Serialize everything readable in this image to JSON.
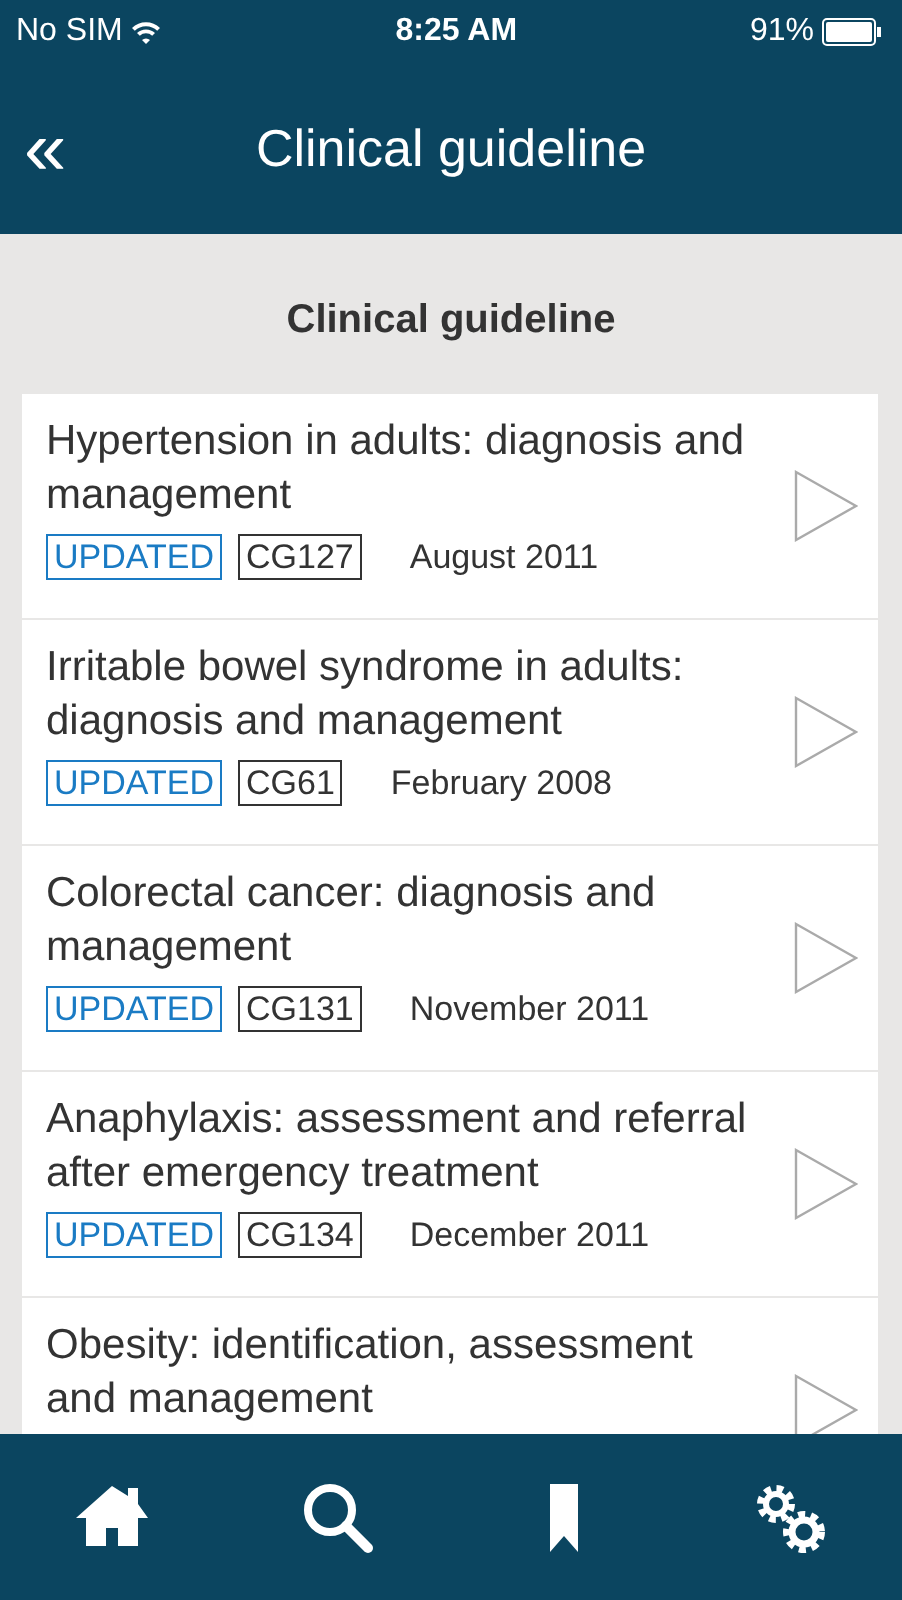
{
  "status_bar": {
    "carrier": "No SIM",
    "time": "8:25 AM",
    "battery": "91%"
  },
  "header": {
    "back": "«",
    "title": "Clinical guideline"
  },
  "section_title": "Clinical guideline",
  "items": [
    {
      "title": "Hypertension in adults: diagnosis and management",
      "status": "UPDATED",
      "code": "CG127",
      "date": "August 2011"
    },
    {
      "title": "Irritable bowel syndrome in adults: diagnosis and management",
      "status": "UPDATED",
      "code": "CG61",
      "date": "February 2008"
    },
    {
      "title": "Colorectal cancer: diagnosis and management",
      "status": "UPDATED",
      "code": "CG131",
      "date": "November 2011"
    },
    {
      "title": "Anaphylaxis: assessment and referral after emergency treatment",
      "status": "UPDATED",
      "code": "CG134",
      "date": "December 2011"
    },
    {
      "title": "Obesity: identification, assessment and management"
    }
  ],
  "tab_bar": [
    {
      "kind": "home"
    },
    {
      "kind": "search"
    },
    {
      "kind": "bookmark"
    },
    {
      "kind": "settings"
    }
  ]
}
